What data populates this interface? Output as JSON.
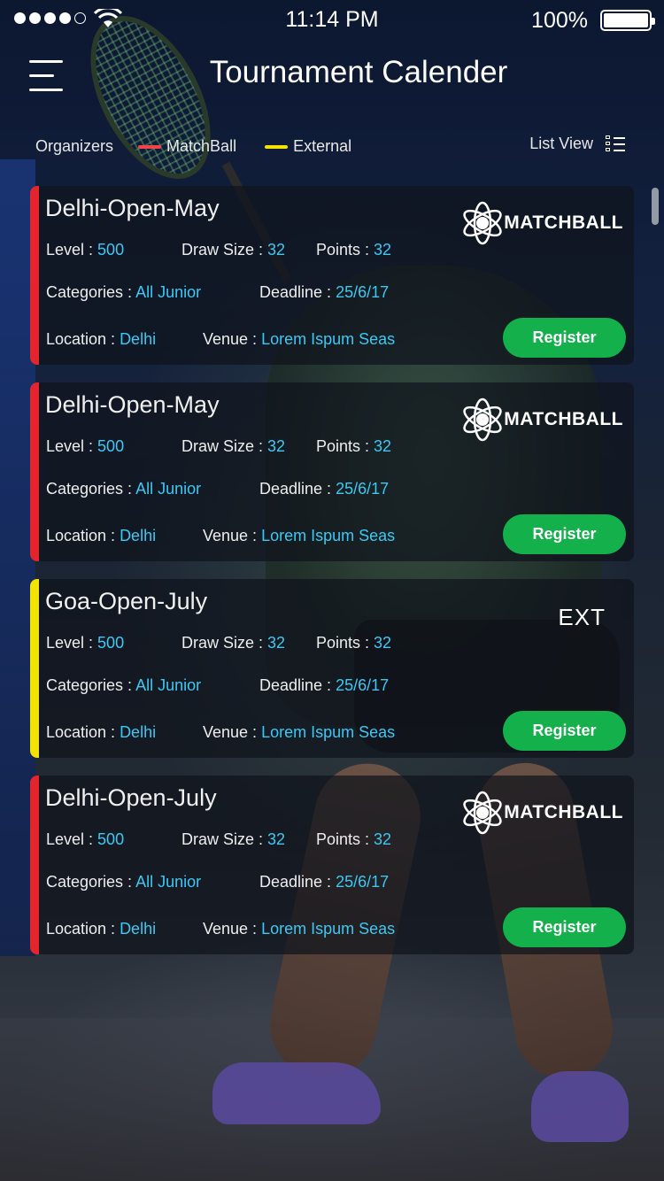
{
  "status_bar": {
    "time": "11:14 PM",
    "battery": "100%",
    "signal_bars": 4,
    "signal_total": 5
  },
  "header": {
    "title": "Tournament Calender"
  },
  "legend": {
    "label": "Organizers",
    "items": [
      {
        "label": "MatchBall",
        "color": "#f0434a"
      },
      {
        "label": "External",
        "color": "#f2e300"
      }
    ],
    "view_label": "List View"
  },
  "colors": {
    "accent_value": "#3cc8f4",
    "register_green": "#13b04b"
  },
  "field_labels": {
    "level": "Level : ",
    "draw_size": "Draw Size : ",
    "points": "Points : ",
    "categories": "Categories : ",
    "deadline": "Deadline : ",
    "location": "Location : ",
    "venue": "Venue : ",
    "register": "Register"
  },
  "logo_text": "MATCHBALL",
  "tournaments": [
    {
      "name": "Delhi-Open-May",
      "organizer": "matchball",
      "bar_color": "#e3262e",
      "level": "500",
      "draw_size": "32",
      "points": "32",
      "categories": "All Junior",
      "deadline": "25/6/17",
      "location": "Delhi",
      "venue": "Lorem Ispum Seas"
    },
    {
      "name": "Delhi-Open-May",
      "organizer": "matchball",
      "bar_color": "#e3262e",
      "level": "500",
      "draw_size": "32",
      "points": "32",
      "categories": "All Junior",
      "deadline": "25/6/17",
      "location": "Delhi",
      "venue": "Lorem Ispum Seas"
    },
    {
      "name": "Goa-Open-July",
      "organizer": "external",
      "badge": "EXT",
      "bar_color": "#f2e300",
      "level": "500",
      "draw_size": "32",
      "points": "32",
      "categories": "All Junior",
      "deadline": "25/6/17",
      "location": "Delhi",
      "venue": "Lorem Ispum Seas"
    },
    {
      "name": "Delhi-Open-July",
      "organizer": "matchball",
      "bar_color": "#e3262e",
      "level": "500",
      "draw_size": "32",
      "points": "32",
      "categories": "All Junior",
      "deadline": "25/6/17",
      "location": "Delhi",
      "venue": "Lorem Ispum Seas"
    }
  ]
}
